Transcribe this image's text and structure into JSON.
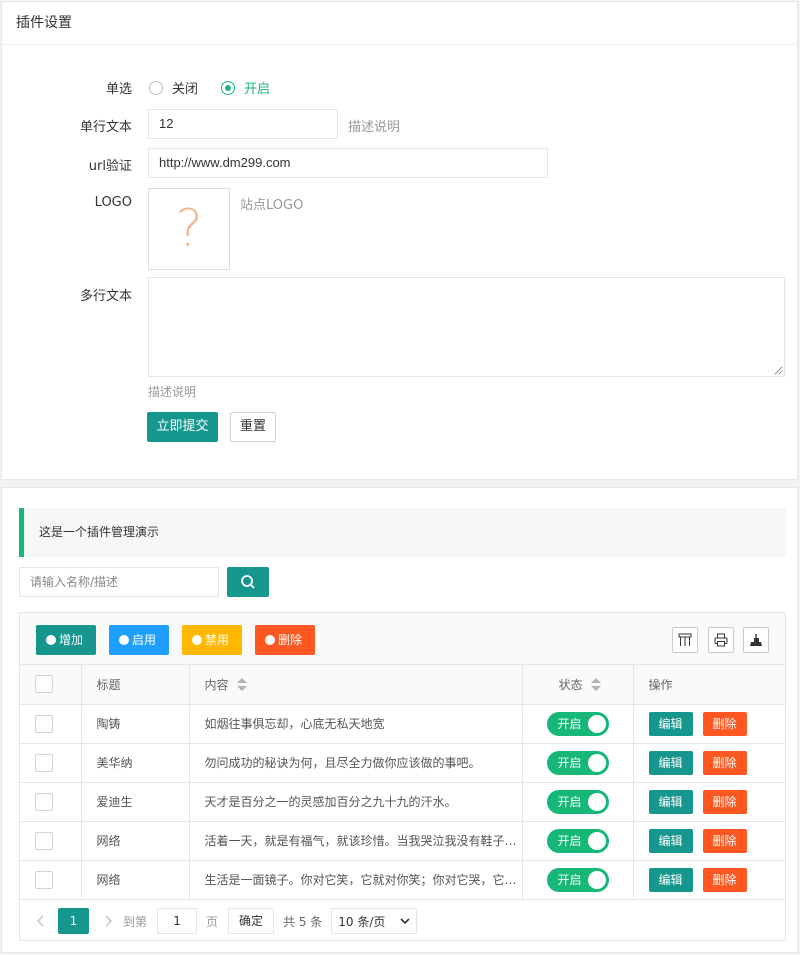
{
  "settings": {
    "title": "插件设置",
    "radio_label": "单选",
    "radio_options": [
      "关闭",
      "开启"
    ],
    "text_label": "单行文本",
    "text_value": "12",
    "text_aux": "描述说明",
    "url_label": "url验证",
    "url_value": "http://www.dm299.com",
    "logo_label": "LOGO",
    "logo_placeholder_glyph": "?",
    "logo_aux": "站点LOGO",
    "textarea_label": "多行文本",
    "textarea_value": "",
    "textarea_aux": "描述说明",
    "submit_label": "立即提交",
    "reset_label": "重置"
  },
  "manager": {
    "notice": "这是一个插件管理演示",
    "search_placeholder": "请输入名称/描述",
    "toolbar": {
      "add": "增加",
      "enable": "启用",
      "disable": "禁用",
      "delete": "删除"
    },
    "columns": [
      "标题",
      "内容",
      "状态",
      "操作"
    ],
    "rows": [
      {
        "title": "陶铸",
        "content": "如烟往事俱忘却，心底无私天地宽",
        "status": "开启"
      },
      {
        "title": "美华纳",
        "content": "勿问成功的秘诀为何，且尽全力做你应该做的事吧。",
        "status": "开启"
      },
      {
        "title": "爱迪生",
        "content": "天才是百分之一的灵感加百分之九十九的汗水。",
        "status": "开启"
      },
      {
        "title": "网络",
        "content": "活着一天，就是有福气，就该珍惜。当我哭泣我没有鞋子穿的时候，我发现有人却没有脚。",
        "status": "开启"
      },
      {
        "title": "网络",
        "content": "生活是一面镜子。你对它笑，它就对你笑；你对它哭，它也对你哭。",
        "status": "开启"
      }
    ],
    "row_actions": {
      "edit": "编辑",
      "delete": "删除"
    },
    "pager": {
      "current": "1",
      "goto_prefix": "到第",
      "goto_value": "1",
      "goto_suffix": "页",
      "confirm": "确定",
      "total": "共 5 条",
      "page_size": "10 条/页"
    }
  },
  "colors": {
    "primary": "#16978d",
    "green": "#16b777",
    "blue": "#1e9fff",
    "orange": "#ffb800",
    "red": "#ff5722"
  }
}
